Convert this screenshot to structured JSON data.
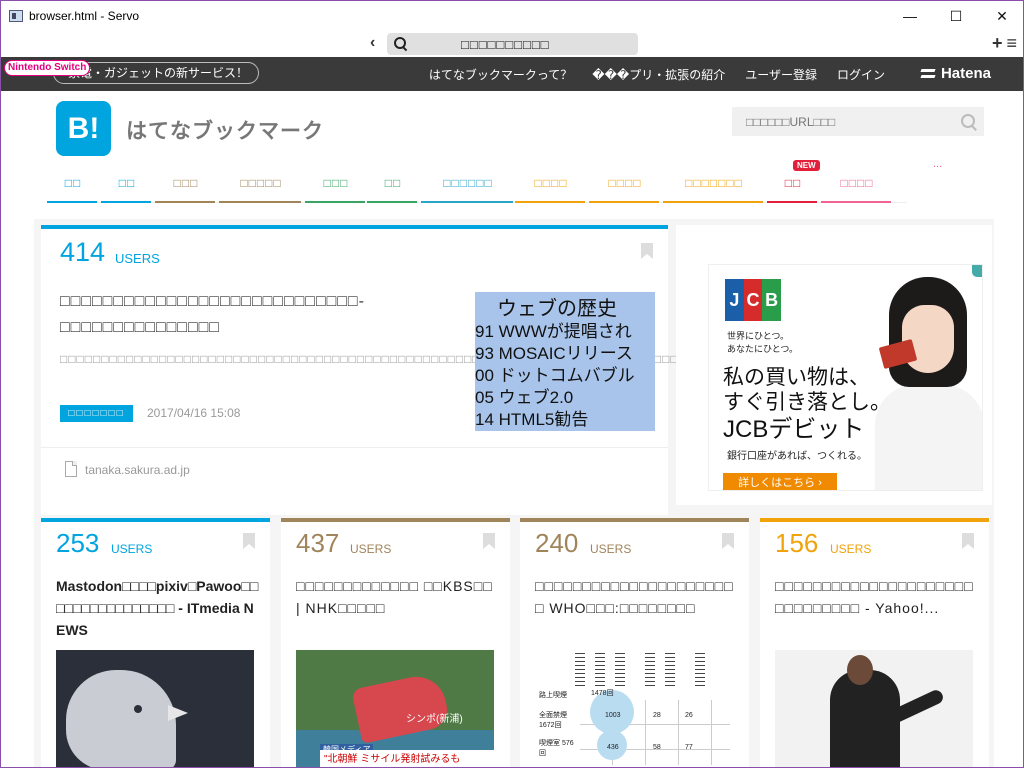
{
  "window": {
    "title": "browser.html - Servo",
    "controls": [
      "—",
      "☐",
      "✕"
    ]
  },
  "browser": {
    "back": "‹",
    "url": "□□□□□□□□□□",
    "actions": [
      "+",
      "≡"
    ]
  },
  "hatena_bar": {
    "nintendo_tag": "Nintendo Switch",
    "promo": "家電・ガジェットの新サービス！",
    "links": [
      "はてなブックマークって？",
      "���プリ・拡張の紹介",
      "ユーザー登録",
      "ログイン"
    ],
    "brand": "Hatena"
  },
  "site": {
    "logo_text": "B!",
    "name": "はてなブックマーク",
    "search_placeholder": "□□□□□□URL□□□"
  },
  "categories": [
    {
      "label": "□□",
      "color": "#00a4de"
    },
    {
      "label": "□□",
      "color": "#00a4de"
    },
    {
      "label": "□□□",
      "color": "#a0845a"
    },
    {
      "label": "□□□□□",
      "color": "#a0845a"
    },
    {
      "label": "□□□",
      "color": "#3aa563"
    },
    {
      "label": "□□",
      "color": "#3aa563"
    },
    {
      "label": "□□□□□□",
      "color": "#2ba6cb"
    },
    {
      "label": "□□□□",
      "color": "#f0a30a"
    },
    {
      "label": "□□□□",
      "color": "#f0a30a"
    },
    {
      "label": "□□□□□□□",
      "color": "#f0a30a"
    },
    {
      "label": "□□",
      "color": "#e2203b"
    },
    {
      "label": "□□□□",
      "color": "#f06292"
    }
  ],
  "new_badge": "NEW",
  "more_dots": "...",
  "featured": {
    "count": "414",
    "users_label": "USERS",
    "title": "□□□□□□□□□□□□□□□□□□□□□□□□□□□□- □□□□□□□□□□□□□□□",
    "description": "□□□□□□□□□□□□□□□□□□□□□□□□□□□□□□□□□□□□□□□□□□□□□□□□□□□□□□□□□□□□□□□□□□□□□□□□□□□□□□□□□□□□...",
    "tag": "□□□□□□□",
    "date": "2017/04/16 15:08",
    "domain": "tanaka.sakura.ad.jp",
    "thumb": {
      "heading": "ウェブの歴史",
      "lines": [
        "91 WWWが提唱され",
        "93 MOSAICリリース",
        "00 ドットコムバブル",
        "05 ウェブ2.0",
        "14 HTML5勧告"
      ]
    }
  },
  "ad": {
    "jcb_letters": [
      "J",
      "C",
      "B"
    ],
    "tagline1": "世界にひとつ。",
    "tagline2": "あなたにひとつ。",
    "headline1": "私の買い物は、",
    "headline2": "すぐ引き落とし。",
    "product": "JCBデビット",
    "sub": "銀行口座があれば、つくれる。",
    "cta": "詳しくはこちら ›"
  },
  "cards": [
    {
      "count": "253",
      "users": "USERS",
      "color": "#00a4de",
      "title": "Mastodon□□□□pixiv□Pawoo□□□□□□□□□□□□□□□□ - ITmedia NEWS",
      "bold": true,
      "image": "mastodon-elephant-image"
    },
    {
      "count": "437",
      "users": "USERS",
      "color": "#a0845a",
      "title": "□□□□□□□□□□□□□ □□KBS□□ | NHK□□□□□",
      "bold": false,
      "image": "korea-map-image",
      "map_label": "シンポ(新浦)",
      "map_caption": "\"北朝鮮 ミサイル発射試みるも",
      "map_chip": "韓国メディア"
    },
    {
      "count": "240",
      "users": "USERS",
      "color": "#a0845a",
      "title": "□□□□□□□□□□□□□□□□□□□□□□ WHO□□□:□□□□□□□□",
      "bold": false,
      "image": "infographic-image",
      "chart_labels": [
        "1478回",
        "1003",
        "436",
        "28",
        "26",
        "58",
        "77"
      ],
      "row_labels": [
        "路上喫煙",
        "全面禁煙 1672回",
        "喫煙室 576回"
      ]
    },
    {
      "count": "156",
      "users": "USERS",
      "color": "#f0a30a",
      "title": "□□□□□□□□□□□□□□□□□□□□□□□□□□□□□□ - Yahoo!...",
      "bold": false,
      "image": "athlete-image"
    }
  ]
}
